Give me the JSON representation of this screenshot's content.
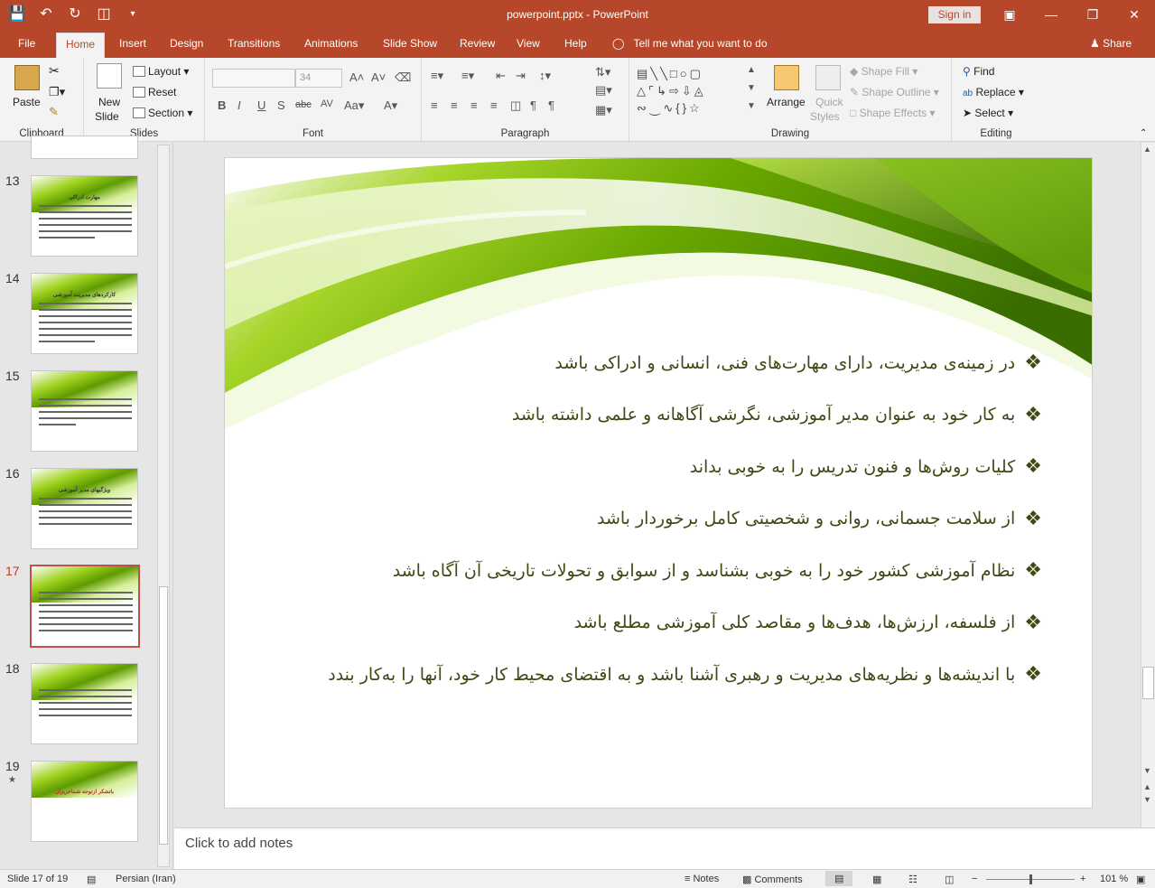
{
  "window": {
    "title": "powerpoint.pptx  -  PowerPoint",
    "sign_in": "Sign in"
  },
  "tabs": [
    "File",
    "Home",
    "Insert",
    "Design",
    "Transitions",
    "Animations",
    "Slide Show",
    "Review",
    "View",
    "Help"
  ],
  "tell_me": "Tell me what you want to do",
  "share": "Share",
  "ribbon": {
    "clipboard": {
      "paste": "Paste",
      "label": "Clipboard"
    },
    "slides": {
      "new_slide_1": "New",
      "new_slide_2": "Slide",
      "layout": "Layout",
      "reset": "Reset",
      "section": "Section",
      "label": "Slides"
    },
    "font": {
      "size": "34",
      "label": "Font"
    },
    "paragraph": {
      "label": "Paragraph"
    },
    "drawing": {
      "arrange": "Arrange",
      "quick_styles_1": "Quick",
      "quick_styles_2": "Styles",
      "shape_fill": "Shape Fill",
      "shape_outline": "Shape Outline",
      "shape_effects": "Shape Effects",
      "label": "Drawing"
    },
    "editing": {
      "find": "Find",
      "replace": "Replace",
      "select": "Select",
      "label": "Editing"
    }
  },
  "thumbnails": [
    {
      "num": "13",
      "title": "مهارت ادراکی"
    },
    {
      "num": "14",
      "title": "کارکردهای مدیریت آموزشی"
    },
    {
      "num": "15",
      "title": ""
    },
    {
      "num": "16",
      "title": "ویژگیهای مدیر آموزشی"
    },
    {
      "num": "17",
      "title": ""
    },
    {
      "num": "18",
      "title": ""
    },
    {
      "num": "19",
      "title": "باتشکر ازتوجه شماعزیزان"
    }
  ],
  "slide": {
    "bullets": [
      "در زمینه‌ی مدیریت، دارای مهارت‌های فنی، انسانی و ادراکی باشد",
      "به کار خود به عنوان مدیر آموزشی، نگرشی آگاهانه و علمی داشته باشد",
      "کلیات روش‌ها و فنون تدریس را به خوبی بداند",
      "از سلامت جسمانی، روانی و شخصیتی کامل برخوردار باشد",
      "نظام آموزشی کشور خود را به خوبی بشناسد و از سوابق و تحولات تاریخی آن آگاه باشد",
      "از فلسفه، ارزش‌ها، هدف‌ها و مقاصد کلی آموزشی مطلع باشد",
      "با اندیشه‌ها و نظریه‌های مدیریت و رهبری آشنا باشد و به اقتضای محیط کار خود، آنها را به‌کار بندد"
    ]
  },
  "notes_placeholder": "Click to add notes",
  "status": {
    "slide_info": "Slide 17 of 19",
    "language": "Persian (Iran)",
    "notes": "Notes",
    "comments": "Comments",
    "zoom": "101 %"
  }
}
